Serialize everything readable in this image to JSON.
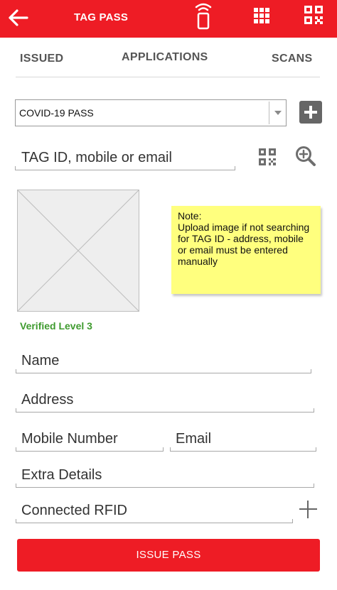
{
  "header": {
    "title": "TAG PASS",
    "back_icon": "arrow-left-icon",
    "rfid_icon": "rfid-phone-icon",
    "grid_icon": "grid-icon",
    "qr_icon": "qr-code-icon"
  },
  "tabs": [
    "ISSUED",
    "APPLICATIONS",
    "SCANS"
  ],
  "pass_type": {
    "selected": "COVID-19 PASS"
  },
  "search": {
    "placeholder": "TAG ID, mobile or email"
  },
  "note": {
    "text": "Note:\nUpload image if not searching for TAG ID - address, mobile or email must be entered manually"
  },
  "verified": "Verified Level 3",
  "fields": {
    "name": "Name",
    "address": "Address",
    "mobile": "Mobile Number",
    "email": "Email",
    "extra": "Extra Details",
    "rfid": "Connected RFID"
  },
  "issue_button": "ISSUE PASS",
  "colors": {
    "brand": "#ee1c25",
    "verified": "#3f9b2f",
    "note_bg": "#ffff7e"
  }
}
